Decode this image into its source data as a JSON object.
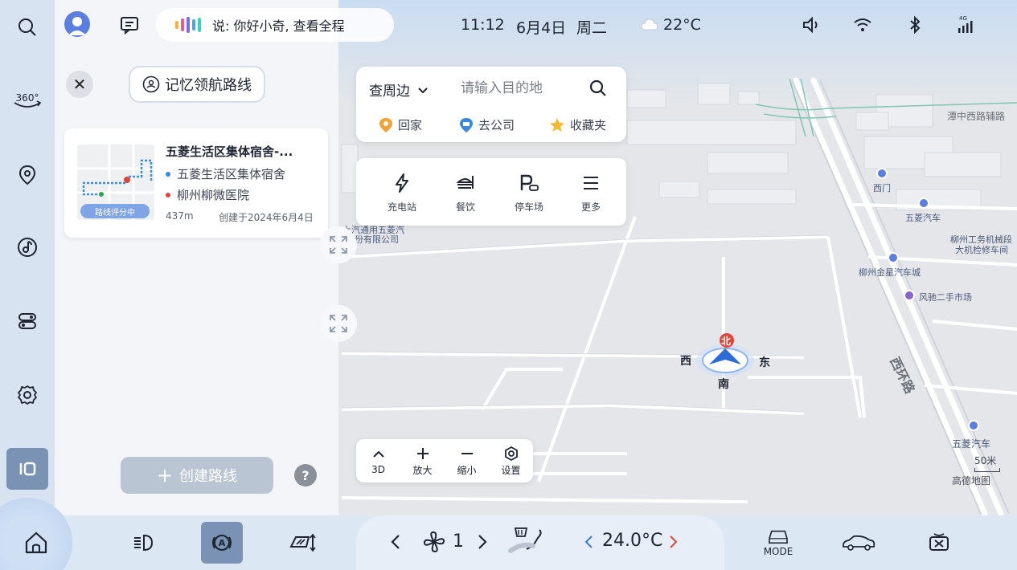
{
  "status": {
    "voice_text": "说: 你好小奇, 查看全程",
    "time": "11:12",
    "date": "6月4日",
    "weekday": "周二",
    "temperature": "22°C"
  },
  "panel": {
    "memory_nav_label": "记忆领航路线",
    "route": {
      "title": "五菱生活区集体宿舍-...",
      "start": "五菱生活区集体宿舍",
      "end": "柳州柳微医院",
      "distance": "437m",
      "created": "创建于2024年6月4日",
      "badge": "路线评分中"
    },
    "create_route_label": "创建路线",
    "help_label": "?"
  },
  "search": {
    "nearby_label": "查周边",
    "placeholder": "请输入目的地",
    "home_label": "回家",
    "work_label": "去公司",
    "favorites_label": "收藏夹"
  },
  "categories": {
    "charging": "充电站",
    "dining": "餐饮",
    "parking": "停车场",
    "more": "更多"
  },
  "map_tools": {
    "mode_3d": "3D",
    "zoom_in": "放大",
    "zoom_out": "缩小",
    "settings": "设置"
  },
  "map": {
    "compass": {
      "north": "北",
      "south": "南",
      "east": "东",
      "west": "西"
    },
    "scale": "50米",
    "brand": "高德地图",
    "labels": {
      "road_tanzhong": "潭中西路辅路",
      "road_xihuan": "西环路",
      "wuling_auto_1": "五菱汽车",
      "wuling_auto_2": "五菱汽车",
      "xi_gate": "西门",
      "liuzhou_inspection": "柳州工务机械段",
      "inspection_2": "大机检修车间",
      "jinxing_auto": "柳州金星汽车城",
      "fengchi_market": "风驰二手市场",
      "company_1": "上汽通用五菱汽",
      "company_2": "股份有限公司"
    }
  },
  "climate": {
    "fan_level": "1",
    "temperature": "24.0°C"
  },
  "dock": {
    "mode_label": "MODE"
  },
  "colors": {
    "accent": "#5b7fe0",
    "rail_active": "#7a93b5",
    "temp_arrow_left": "#3a7be0",
    "temp_arrow_right": "#e0453a"
  }
}
